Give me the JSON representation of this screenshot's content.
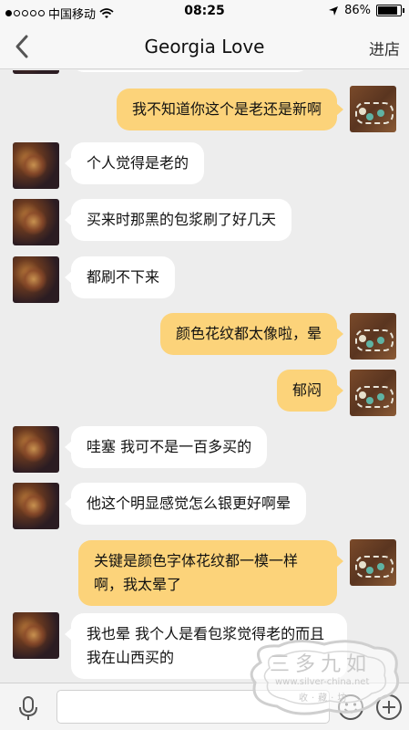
{
  "status_bar": {
    "carrier": "中国移动",
    "time": "08:25",
    "battery": "86%",
    "battery_level": 0.86
  },
  "nav": {
    "title": "Georgia Love",
    "right_action": "进店"
  },
  "messages": [
    {
      "from": "self",
      "text": "我不知道你这个是老还是新啊"
    },
    {
      "from": "other",
      "text": "个人觉得是老的"
    },
    {
      "from": "other",
      "text": "买来时那黑的包浆刷了好几天"
    },
    {
      "from": "other",
      "text": "都刷不下来"
    },
    {
      "from": "self",
      "text": "颜色花纹都太像啦，晕"
    },
    {
      "from": "self",
      "text": "郁闷"
    },
    {
      "from": "other",
      "text": "哇塞 我可不是一百多买的"
    },
    {
      "from": "other",
      "text": "他这个明显感觉怎么银更好啊晕"
    },
    {
      "from": "self",
      "text": "关键是颜色字体花纹都一模一样啊，我太晕了"
    },
    {
      "from": "other",
      "text": "我也晕 我个人是看包浆觉得老的而且 我在山西买的"
    }
  ],
  "watermark": {
    "title": "三多九如",
    "url": "www.silver-china.net",
    "subtitle": "收·藏·坊"
  }
}
